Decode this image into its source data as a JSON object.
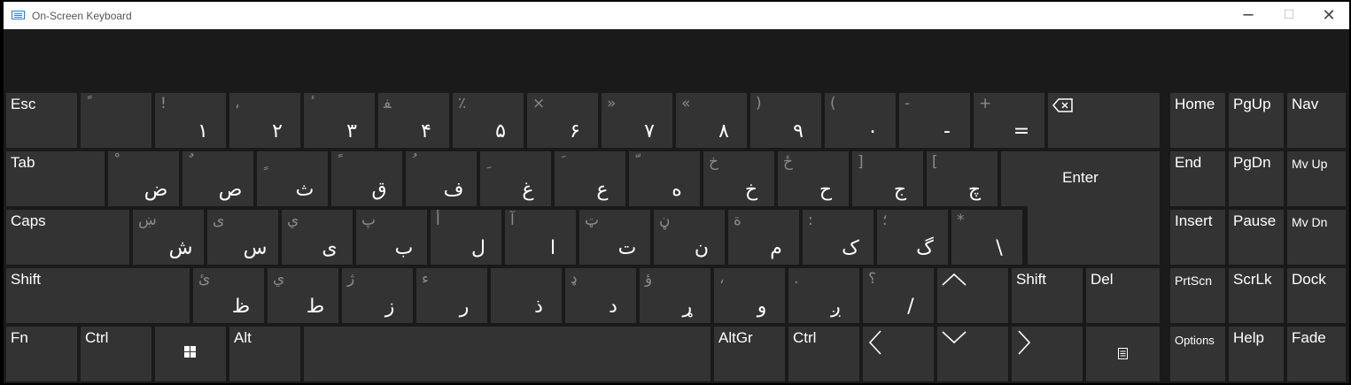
{
  "window": {
    "title": "On-Screen Keyboard",
    "minimize": "─",
    "maximize": "☐",
    "close": "✕"
  },
  "colors": {
    "key_bg": "#333333",
    "board_bg": "#1a1a1a",
    "secondary_text": "#8a8a8a"
  },
  "row1": [
    {
      "label": "Esc"
    },
    {
      "shift": "ً",
      "main": ""
    },
    {
      "shift": "!",
      "main": "١"
    },
    {
      "shift": "،",
      "main": "٢"
    },
    {
      "shift": "ٔ",
      "main": "٣"
    },
    {
      "shift": "ﻔ",
      "main": "۴"
    },
    {
      "shift": "٪",
      "main": "۵"
    },
    {
      "shift": "×",
      "main": "۶"
    },
    {
      "shift": "»",
      "main": "٧"
    },
    {
      "shift": "«",
      "main": "٨"
    },
    {
      "shift": ")",
      "main": "٩"
    },
    {
      "shift": "(",
      "main": "٠"
    },
    {
      "shift": "-",
      "main": "-"
    },
    {
      "shift": "+",
      "main": "="
    },
    {
      "icon": "backspace-icon"
    }
  ],
  "row2": [
    {
      "label": "Tab"
    },
    {
      "shift": "ْ",
      "main": "ض"
    },
    {
      "shift": "ٌ",
      "main": "ص"
    },
    {
      "shift": "ٍ",
      "main": "ث"
    },
    {
      "shift": "ً",
      "main": "ق"
    },
    {
      "shift": "ُ",
      "main": "ف"
    },
    {
      "shift": "ِ",
      "main": "غ"
    },
    {
      "shift": "َ",
      "main": "ع"
    },
    {
      "shift": "ّ",
      "main": "ه"
    },
    {
      "shift": "خ",
      "main": "خ"
    },
    {
      "shift": "ځ",
      "main": "ح"
    },
    {
      "shift": "]",
      "main": "ج"
    },
    {
      "shift": "[",
      "main": "چ"
    },
    {
      "label": "Enter"
    }
  ],
  "row3": [
    {
      "label": "Caps"
    },
    {
      "shift": "ښ",
      "main": "ش"
    },
    {
      "shift": "ی",
      "main": "س"
    },
    {
      "shift": "ي",
      "main": "ی"
    },
    {
      "shift": "پ",
      "main": "ب"
    },
    {
      "shift": "أ",
      "main": "ل"
    },
    {
      "shift": "آ",
      "main": "ا"
    },
    {
      "shift": "ټ",
      "main": "ت"
    },
    {
      "shift": "ڼ",
      "main": "ن"
    },
    {
      "shift": "ة",
      "main": "م"
    },
    {
      "shift": ":",
      "main": "ک"
    },
    {
      "shift": "؛",
      "main": "گ"
    },
    {
      "shift": "*",
      "main": "\\"
    }
  ],
  "row4": [
    {
      "label": "Shift"
    },
    {
      "shift": "ئ",
      "main": "ظ"
    },
    {
      "shift": "ي",
      "main": "ط"
    },
    {
      "shift": "ژ",
      "main": "ز"
    },
    {
      "shift": "ء",
      "main": "ر"
    },
    {
      "shift": "",
      "main": "ذ"
    },
    {
      "shift": "ډ",
      "main": "د"
    },
    {
      "shift": "ؤ",
      "main": "ړ"
    },
    {
      "shift": "،",
      "main": "و"
    },
    {
      "shift": ".",
      "main": "ږ"
    },
    {
      "shift": "؟",
      "main": "/"
    },
    {
      "icon": "up-arrow-icon"
    },
    {
      "label": "Shift"
    },
    {
      "label": "Del"
    }
  ],
  "row5": [
    {
      "label": "Fn"
    },
    {
      "label": "Ctrl"
    },
    {
      "icon": "windows-icon"
    },
    {
      "label": "Alt"
    },
    {
      "label": ""
    },
    {
      "label": "AltGr"
    },
    {
      "label": "Ctrl"
    },
    {
      "icon": "left-arrow-icon"
    },
    {
      "icon": "down-arrow-icon"
    },
    {
      "icon": "right-arrow-icon"
    },
    {
      "icon": "menu-icon"
    }
  ],
  "nav": {
    "home": "Home",
    "pgup": "PgUp",
    "nav": "Nav",
    "end": "End",
    "pgdn": "PgDn",
    "mvup": "Mv Up",
    "insert": "Insert",
    "pause": "Pause",
    "mvdn": "Mv Dn",
    "prtscn": "PrtScn",
    "scrlk": "ScrLk",
    "dock": "Dock",
    "options": "Options",
    "help": "Help",
    "fade": "Fade"
  }
}
